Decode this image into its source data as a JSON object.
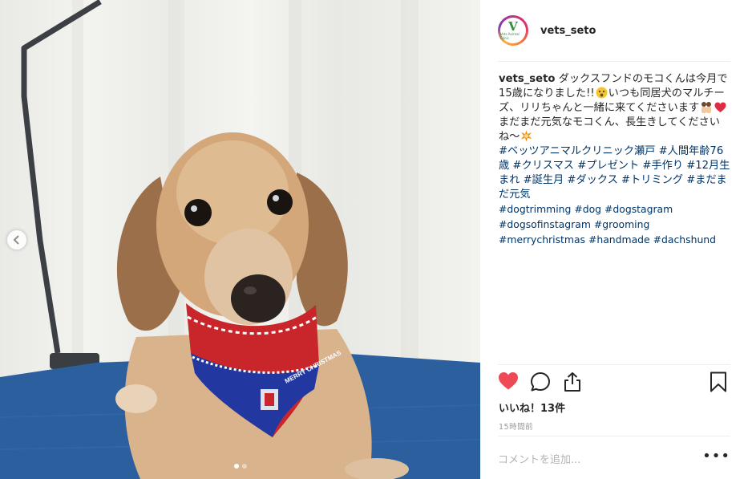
{
  "post": {
    "username": "vets_seto",
    "avatar_text": {
      "letter": "V",
      "sub": "Vets Animal Clinic"
    },
    "caption": {
      "text_1": "ダックスフンドのモコくんは今月で15歳になりました!!",
      "text_2": "いつも同居犬のマルチーズ、リリちゃんと一緒に来てくださいます",
      "text_3": "まだまだ元気なモコくん、長生きしてくださいね〜",
      "tags_ja": [
        "#ベッツアニマルクリニック瀬戸",
        "#人間年齢76歳",
        "#クリスマス",
        "#プレゼント",
        "#手作り",
        "#12月生まれ",
        "#誕生月",
        "#ダックス",
        "#トリミング",
        "#まだまだ元気"
      ],
      "tags_en": [
        "#dogtrimming",
        "#dog",
        "#dogstagram",
        "#dogsofinstagram",
        "#grooming",
        "#merrychristmas",
        "#handmade",
        "#dachshund"
      ]
    },
    "likes_label": "いいね！13件",
    "time_label": "15時間前",
    "comment_placeholder": "コメントを追加...",
    "more_label": "•••",
    "bandana_text": "MERRY CHRISTMAS",
    "carousel": {
      "count": 2,
      "active": 0
    },
    "colors": {
      "like_red": "#ed4956",
      "link": "#003569",
      "table_blue": "#2b5f9e"
    },
    "icons": [
      "chevron-left-icon",
      "heart-icon",
      "comment-icon",
      "share-icon",
      "bookmark-icon",
      "more-icon"
    ]
  }
}
